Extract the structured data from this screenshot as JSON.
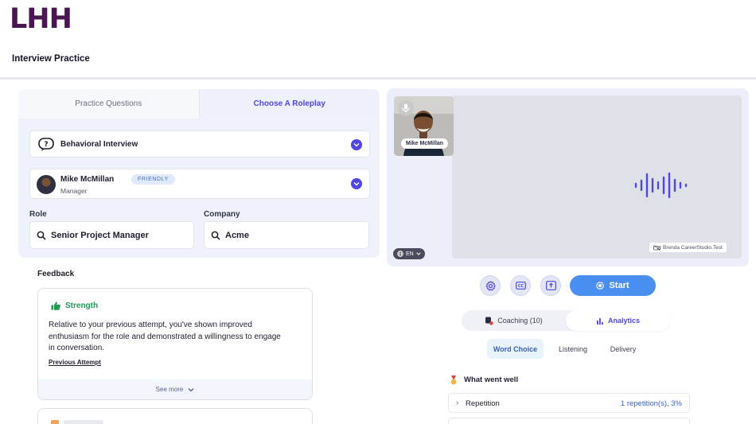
{
  "header": {
    "logo": "LHH",
    "title": "Interview Practice"
  },
  "tabs": [
    {
      "label": "Practice Questions",
      "active": false
    },
    {
      "label": "Choose A Roleplay",
      "active": true
    }
  ],
  "interview_select": {
    "label": "Behavioral Interview",
    "icon": "question-bubble-icon"
  },
  "persona": {
    "name": "Mike McMillan",
    "role": "Manager",
    "badge": "FRIENDLY"
  },
  "fields": {
    "role_label": "Role",
    "role_value": "Senior Project Manager",
    "company_label": "Company",
    "company_value": "Acme"
  },
  "feedback": {
    "title": "Feedback",
    "strength_label": "Strength",
    "text": "Relative to your previous attempt, you've shown improved enthusiasm for the role and demonstrated a willingness to engage in conversation.",
    "link": "Previous Attempt",
    "see_more": "See more"
  },
  "video": {
    "participant_label": "Mike McMillan",
    "language": "EN",
    "camera_user": "Brenda CareerStudio.Test"
  },
  "controls": {
    "start_label": "Start"
  },
  "segments": [
    {
      "label": "Coaching (10)",
      "active": false,
      "icon": "coaching-icon"
    },
    {
      "label": "Analytics",
      "active": true,
      "icon": "bar-chart-icon"
    }
  ],
  "subtabs": [
    {
      "label": "Word Choice",
      "active": true
    },
    {
      "label": "Listening",
      "active": false
    },
    {
      "label": "Delivery",
      "active": false
    }
  ],
  "analytics": {
    "went_well": "What went well",
    "row_label": "Repetition",
    "row_value": "1 repetition(s), 3%"
  },
  "colors": {
    "accent": "#4f46e5",
    "brand": "#4a1552",
    "start": "#4a8ef0",
    "strength": "#1f9a55"
  }
}
